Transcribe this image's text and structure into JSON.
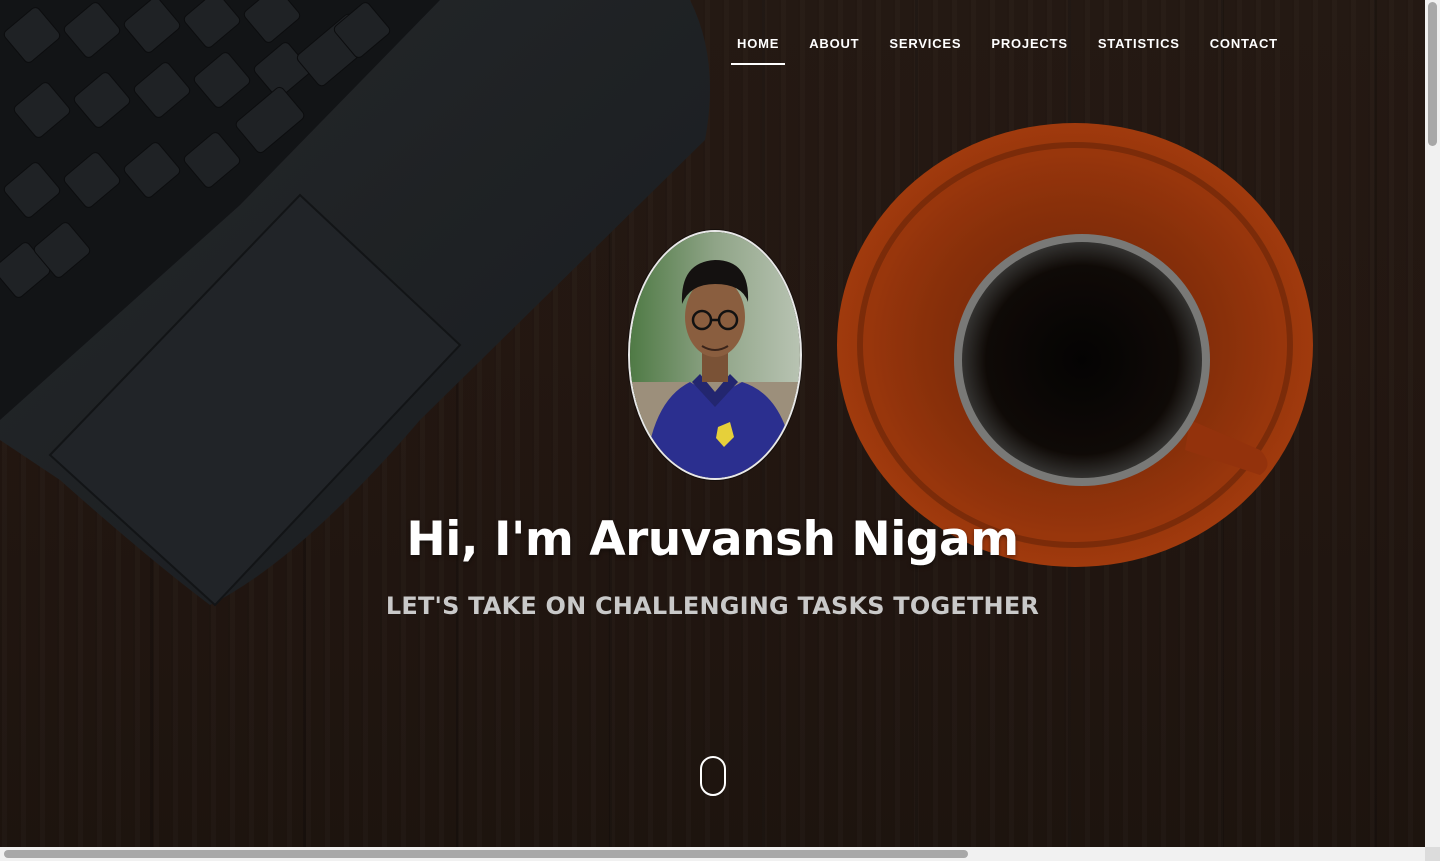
{
  "nav": {
    "items": [
      {
        "label": "HOME",
        "active": true
      },
      {
        "label": "ABOUT",
        "active": false
      },
      {
        "label": "SERVICES",
        "active": false
      },
      {
        "label": "PROJECTS",
        "active": false
      },
      {
        "label": "STATISTICS",
        "active": false
      },
      {
        "label": "CONTACT",
        "active": false
      }
    ]
  },
  "hero": {
    "title": "Hi, I'm Aruvansh Nigam",
    "subtitle": "LET'S TAKE ON CHALLENGING TASKS TOGETHER",
    "background": "laptop-and-coffee-photo",
    "scroll_indicator": "mouse-scroll-icon"
  },
  "colors": {
    "text": "#ffffff",
    "subtitle": "#c9c9c9",
    "saucer": "#c2410c",
    "wood": "#2b1e17"
  }
}
